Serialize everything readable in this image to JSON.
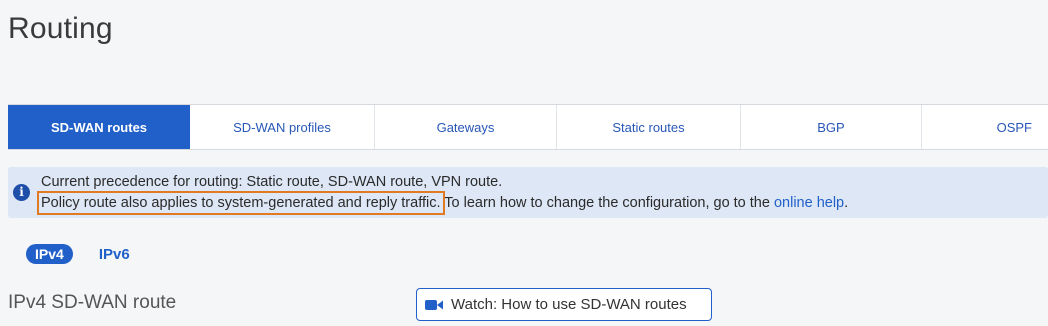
{
  "page": {
    "title": "Routing"
  },
  "tabs": [
    {
      "label": "SD-WAN routes",
      "active": true
    },
    {
      "label": "SD-WAN profiles",
      "active": false
    },
    {
      "label": "Gateways",
      "active": false
    },
    {
      "label": "Static routes",
      "active": false
    },
    {
      "label": "BGP",
      "active": false
    },
    {
      "label": "OSPF",
      "active": false
    }
  ],
  "info_banner": {
    "icon": "info-icon",
    "icon_glyph": "i",
    "line1": "Current precedence for routing: Static route, SD-WAN route, VPN route.",
    "line2_highlighted": "Policy route also applies to system-generated and reply traffic.",
    "line2_rest": " To learn how to change the configuration, go to the ",
    "help_link": "online help",
    "line2_end": ".",
    "highlight_color": "#e07b22"
  },
  "ip_toggle": {
    "ipv4": "IPv4",
    "ipv6": "IPv6",
    "selected": "IPv4"
  },
  "section": {
    "title": "IPv4 SD-WAN route"
  },
  "watch_button": {
    "icon": "video-camera-icon",
    "label": "Watch: How to use SD-WAN routes"
  },
  "colors": {
    "accent": "#2160c9",
    "banner_bg": "#dde7f5",
    "page_bg": "#f5f6f8"
  }
}
